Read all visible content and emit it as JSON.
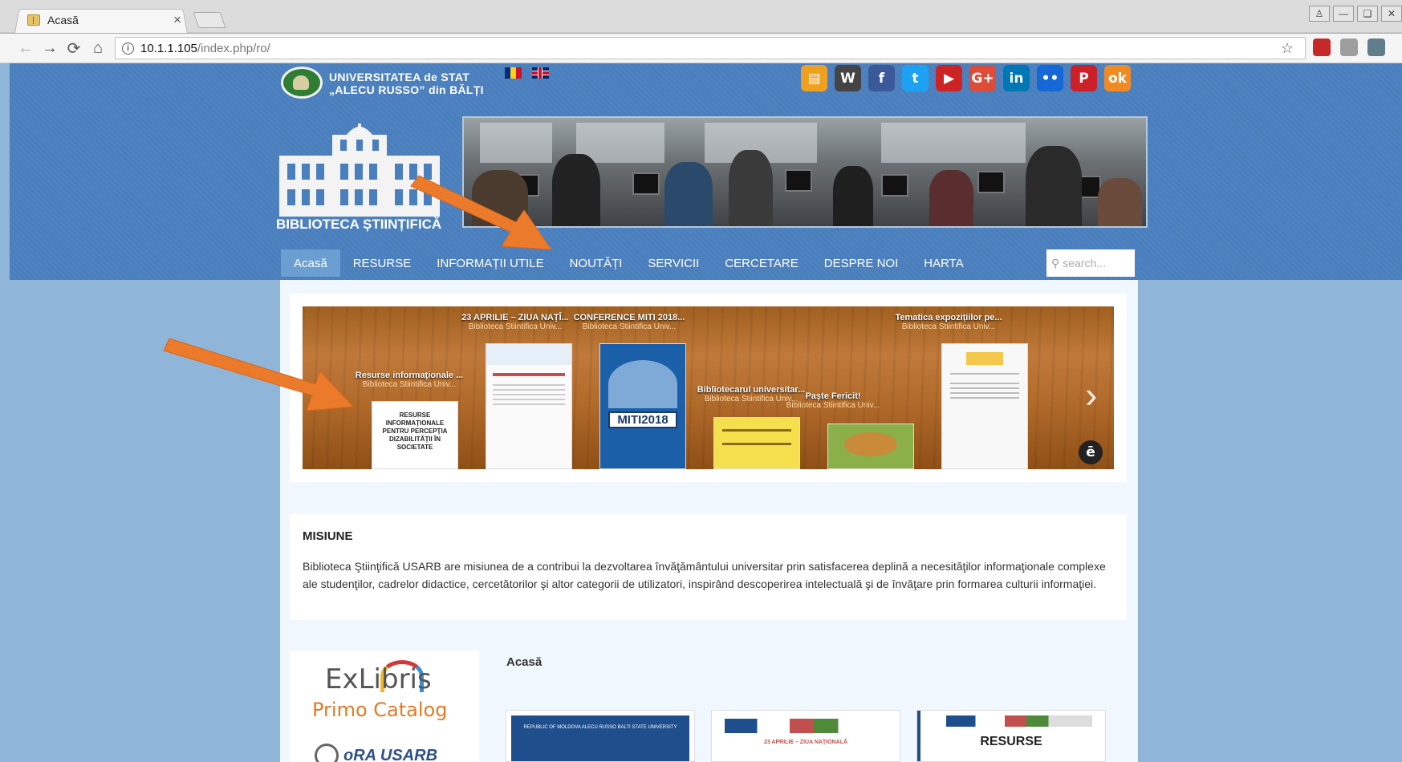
{
  "browser": {
    "tab_title": "Acasă",
    "tab_close": "×",
    "url_host": "10.1.1.105",
    "url_path": "/index.php/ro/"
  },
  "header": {
    "university_line1": "UNIVERSITATEA de STAT",
    "university_line2": "„ALECU RUSSO” din BĂLȚI",
    "library_title": "BIBLIOTECA ȘTIINȚIFICĂ",
    "languages": [
      "ro",
      "en"
    ],
    "social_icons": [
      {
        "name": "news-icon",
        "glyph": "▤",
        "color": "#f0a020"
      },
      {
        "name": "wikipedia-icon",
        "glyph": "W",
        "color": "#444444"
      },
      {
        "name": "facebook-icon",
        "glyph": "f",
        "color": "#3b5998"
      },
      {
        "name": "twitter-icon",
        "glyph": "t",
        "color": "#1da1f2"
      },
      {
        "name": "youtube-icon",
        "glyph": "▶",
        "color": "#cc2424"
      },
      {
        "name": "google-plus-icon",
        "glyph": "G+",
        "color": "#dd4b39"
      },
      {
        "name": "linkedin-icon",
        "glyph": "in",
        "color": "#0077b5"
      },
      {
        "name": "flickr-icon",
        "glyph": "••",
        "color": "#1668d6"
      },
      {
        "name": "pinterest-icon",
        "glyph": "P",
        "color": "#cb2027"
      },
      {
        "name": "odnoklassniki-icon",
        "glyph": "ok",
        "color": "#f28a24"
      }
    ]
  },
  "nav": {
    "items": [
      "Acasă",
      "RESURSE",
      "INFORMAȚII UTILE",
      "NOUTĂȚI",
      "SERVICII",
      "CERCETARE",
      "DESPRE NOI",
      "HARTA"
    ],
    "active_index": 0,
    "search_placeholder": "search..."
  },
  "slider": {
    "slides": [
      {
        "title": "Resurse informaţionale ...",
        "subtitle": "Biblioteca Stiintifica Univ..."
      },
      {
        "title": "23 APRILIE – ZIUA NAȚÎ...",
        "subtitle": "Biblioteca Stiintifica Univ..."
      },
      {
        "title": "CONFERENCE MITI 2018...",
        "subtitle": "Biblioteca Stiintifica Univ..."
      },
      {
        "title": "Bibliotecarul universitar...",
        "subtitle": "Biblioteca Stiintifica Univ..."
      },
      {
        "title": "Paşte Fericit!",
        "subtitle": "Biblioteca Stiintifica Univ..."
      },
      {
        "title": "Tematica expozițiilor pe...",
        "subtitle": "Biblioteca Stiintifica Univ..."
      }
    ],
    "cover_texts": {
      "resurse_cover": "RESURSE INFORMAŢIONALE PENTRU PERCEPŢIA DIZABILITĂŢII ÎN SOCIETATE",
      "miti_cover": "MITI2018"
    },
    "badge": "ē"
  },
  "mission": {
    "title": "MISIUNE",
    "text": "Biblioteca Ştiinţifică USARB are misiunea de a contribui la dezvoltarea învăţământului universitar prin satisfacerea deplină a necesităţilor informaţionale complexe ale studenţilor, cadrelor didactice, cercetătorilor şi altor categorii de utilizatori, inspirând descoperirea intelectuală şi de învăţare prin formarea culturii informaţiei."
  },
  "exlibris": {
    "brand": "ExLibris",
    "product": "Primo Catalog",
    "bottom_text": "oRA USARB"
  },
  "main": {
    "heading": "Acasă",
    "thumbs": [
      {
        "caption": "REPUBLIC OF MOLDOVA ALECU RUSSO BALTI STATE UNIVERSITY"
      },
      {
        "caption": "23 APRILIE – ZIUA NAŢIONALĂ"
      },
      {
        "caption": "RESURSE"
      }
    ]
  }
}
